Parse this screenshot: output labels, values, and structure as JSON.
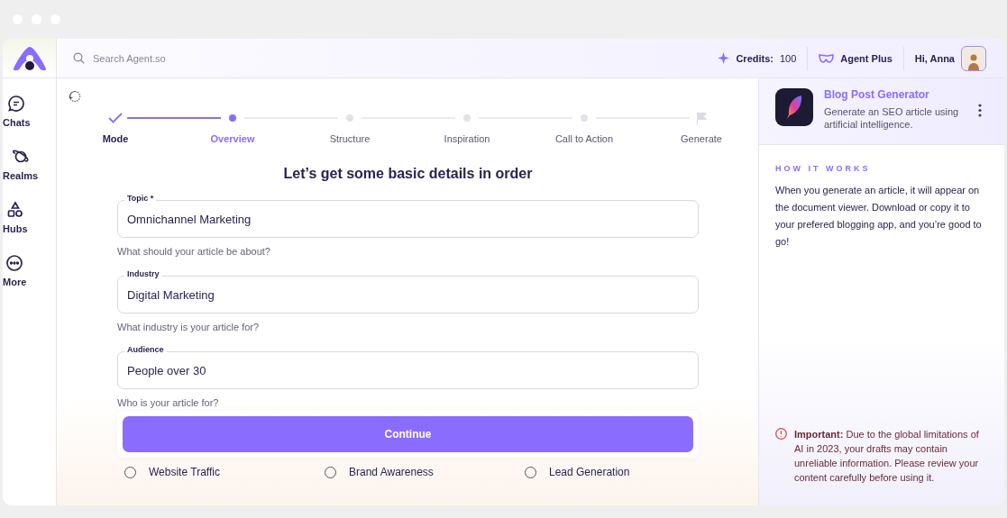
{
  "sidebar": {
    "items": [
      {
        "label": "Chats",
        "selected": false
      },
      {
        "label": "Realms",
        "selected": false
      },
      {
        "label": "Hubs",
        "selected": false
      },
      {
        "label": "More",
        "selected": false
      }
    ]
  },
  "header": {
    "search": {
      "placeholder": "Search Agent.so"
    },
    "credits_label": "Credits:",
    "credits_value": "100",
    "plan": "Agent Plus",
    "greeting": "Hi, Anna"
  },
  "steps": [
    {
      "label": "Mode",
      "done": true,
      "selected": false
    },
    {
      "label": "Overview",
      "done": false,
      "selected": true
    },
    {
      "label": "Structure",
      "done": false,
      "selected": false
    },
    {
      "label": "Inspiration",
      "done": false,
      "selected": false
    },
    {
      "label": "Call to Action",
      "done": false,
      "selected": false
    },
    {
      "label": "Generate",
      "done": false,
      "selected": false
    }
  ],
  "form": {
    "heading": "Let’s get some basic details in order",
    "fields": [
      {
        "label": "Topic *",
        "value": "Omnichannel Marketing",
        "helper": "What should your article be about?"
      },
      {
        "label": "Industry",
        "value": "Digital Marketing",
        "helper": "What industry is your article for?"
      },
      {
        "label": "Audience",
        "value": "People over 30",
        "helper": "Who is your article for?"
      }
    ],
    "continue_button": "Continue",
    "goals": [
      {
        "label": "Website Traffic",
        "selected": false
      },
      {
        "label": "Brand Awareness",
        "selected": false
      },
      {
        "label": "Lead Generation",
        "selected": false
      }
    ]
  },
  "panel": {
    "title": "Blog Post Generator",
    "subtitle": "Generate an SEO article using artificial intelligence.",
    "section_title": "HOW IT WORKS",
    "body": "When you generate an article, it will appear on the document viewer. Download or copy it to your prefered blogging app, and you’re good to go!",
    "notice": "**Important:** Due to the global limitations of AI in 2023, your drafts may contain unreliable information. Please review your content carefully before using it."
  }
}
